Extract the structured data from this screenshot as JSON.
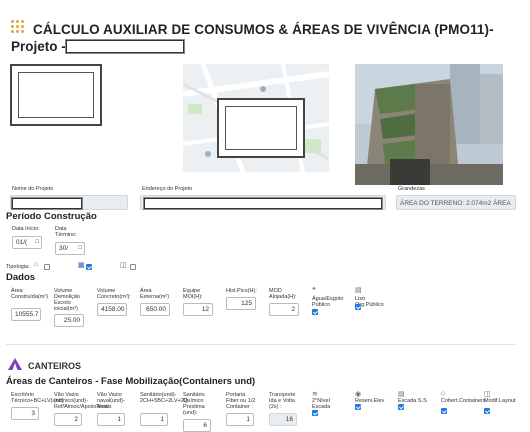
{
  "header": {
    "title_line1": "CÁLCULO AUXILIAR DE CONSUMOS & ÁREAS DE VIVÊNCIA (PMO11)-",
    "title_line2": "Projeto -"
  },
  "info": {
    "nome_label": "Nome do Projeto",
    "endereco_label": "Endereço do Projeto",
    "grandezas_label": "Grandezas",
    "area_terreno": "ÁREA DO TERRENO: 2.074m2 ÁREA"
  },
  "periodo": {
    "title": "Período Construção",
    "inicio_label": "Data Início:",
    "inicio_value": "01/(",
    "termino_label": "Data Término:",
    "termino_value": "30/"
  },
  "tipologia": {
    "label": "Tipologia:"
  },
  "dados": {
    "title": "Dados",
    "fields": [
      {
        "label": "Área Construída(m²)",
        "value": "10555.7"
      },
      {
        "label": "Volume Demolição Escoto inicial(m³)",
        "value": "25.00"
      },
      {
        "label": "Volume Concreto(m³):",
        "value": "4158.00"
      },
      {
        "label": "Área Externa(m²)",
        "value": "650.00"
      },
      {
        "label": "Equipe MOI(H):",
        "value": "12"
      },
      {
        "label": "Hist.Pico(H):",
        "value": "125"
      },
      {
        "label": "MOD Alojada(H):",
        "value": "2"
      }
    ],
    "checks": [
      {
        "label": "Água/Esgoto Público",
        "checked": true
      },
      {
        "label": "Lixo Org.Público",
        "checked": true
      }
    ]
  },
  "canteiros": {
    "title": "CANTEIROS",
    "subtitle": "Áreas de Canteiros - Fase Mobilização(Containers und)",
    "fields": [
      {
        "label": "Escritório Técnico+BC+LV(und)",
        "value": "3"
      },
      {
        "label": "Vão Vazio (técnico(und)- Ref/Almoc/Apoio/Area",
        "value": "2"
      },
      {
        "label": "Vão Vazio naval(und)- Vestix",
        "value": "1"
      },
      {
        "label": "Sanitário(und)- 2CH+5BC+2LV+2D",
        "value": "1"
      },
      {
        "label": "Sanitário Químico Prestima (und):",
        "value": "6"
      },
      {
        "label": "Portaria Fiber ou 1/2 Container :",
        "value": "1"
      },
      {
        "label": "Transporte Ida e Volta (2x) :",
        "value": "16"
      }
    ],
    "checks": [
      {
        "label": "2°Nível Escada",
        "checked": true
      },
      {
        "label": "Reserv.Elev",
        "checked": true
      },
      {
        "label": "Escada S.S",
        "checked": true
      },
      {
        "label": "Cobert.Containers",
        "checked": true
      },
      {
        "label": "Modif.Layout",
        "checked": true
      }
    ]
  }
}
